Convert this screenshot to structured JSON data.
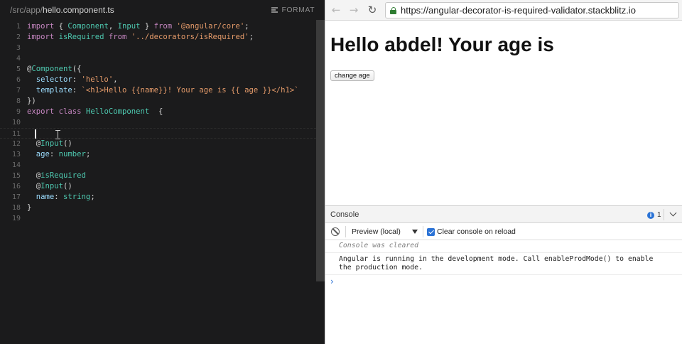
{
  "editor": {
    "breadcrumb_path": "/src/app/",
    "breadcrumb_file": "hello.component.ts",
    "format_label": "FORMAT",
    "lines": [
      {
        "n": "1",
        "tokens": [
          [
            "k",
            "import"
          ],
          [
            "p",
            " { "
          ],
          [
            "t",
            "Component"
          ],
          [
            "p",
            ", "
          ],
          [
            "t",
            "Input"
          ],
          [
            "p",
            " } "
          ],
          [
            "k",
            "from"
          ],
          [
            "p",
            " "
          ],
          [
            "s",
            "'@angular/core'"
          ],
          [
            "p",
            ";"
          ]
        ]
      },
      {
        "n": "2",
        "tokens": [
          [
            "k",
            "import"
          ],
          [
            "p",
            " "
          ],
          [
            "t",
            "isRequired"
          ],
          [
            "p",
            " "
          ],
          [
            "k",
            "from"
          ],
          [
            "p",
            " "
          ],
          [
            "s",
            "'../decorators/isRequired'"
          ],
          [
            "p",
            ";"
          ]
        ]
      },
      {
        "n": "3",
        "tokens": []
      },
      {
        "n": "4",
        "tokens": []
      },
      {
        "n": "5",
        "tokens": [
          [
            "p",
            "@"
          ],
          [
            "t",
            "Component"
          ],
          [
            "p",
            "({"
          ]
        ]
      },
      {
        "n": "6",
        "tokens": [
          [
            "pr",
            "  selector"
          ],
          [
            "p",
            ": "
          ],
          [
            "s",
            "'hello'"
          ],
          [
            "p",
            ","
          ]
        ]
      },
      {
        "n": "7",
        "tokens": [
          [
            "pr",
            "  template"
          ],
          [
            "p",
            ": "
          ],
          [
            "s",
            "`<h1>Hello {{name}}! Your age is {{ age }}</h1>`"
          ]
        ]
      },
      {
        "n": "8",
        "tokens": [
          [
            "p",
            "})"
          ]
        ]
      },
      {
        "n": "9",
        "tokens": [
          [
            "k",
            "export"
          ],
          [
            "p",
            " "
          ],
          [
            "k",
            "class"
          ],
          [
            "p",
            " "
          ],
          [
            "t",
            "HelloComponent"
          ],
          [
            "p",
            "  {"
          ]
        ]
      },
      {
        "n": "10",
        "tokens": []
      },
      {
        "n": "11",
        "tokens": [],
        "active": true
      },
      {
        "n": "12",
        "tokens": [
          [
            "p",
            "  @"
          ],
          [
            "t",
            "Input"
          ],
          [
            "p",
            "()"
          ]
        ]
      },
      {
        "n": "13",
        "tokens": [
          [
            "pr",
            "  age"
          ],
          [
            "p",
            ": "
          ],
          [
            "t",
            "number"
          ],
          [
            "p",
            ";"
          ]
        ]
      },
      {
        "n": "14",
        "tokens": []
      },
      {
        "n": "15",
        "tokens": [
          [
            "p",
            "  @"
          ],
          [
            "t",
            "isRequired"
          ]
        ]
      },
      {
        "n": "16",
        "tokens": [
          [
            "p",
            "  @"
          ],
          [
            "t",
            "Input"
          ],
          [
            "p",
            "()"
          ]
        ]
      },
      {
        "n": "17",
        "tokens": [
          [
            "pr",
            "  name"
          ],
          [
            "p",
            ": "
          ],
          [
            "t",
            "string"
          ],
          [
            "p",
            ";"
          ]
        ]
      },
      {
        "n": "18",
        "tokens": [
          [
            "p",
            "}"
          ]
        ]
      },
      {
        "n": "19",
        "tokens": []
      }
    ]
  },
  "browser": {
    "back_icon": "arrow-left",
    "forward_icon": "arrow-right",
    "reload_icon": "reload",
    "url": "https://angular-decorator-is-required-validator.stackblitz.io",
    "page_heading": "Hello abdel! Your age is",
    "change_age_button": "change age"
  },
  "console": {
    "tab_label": "Console",
    "info_count": "1",
    "context_label": "Preview (local)",
    "clear_on_reload_label": "Clear console on reload",
    "clear_on_reload_checked": true,
    "cleared_message": "Console was cleared",
    "angular_message": "Angular is running in the development mode. Call enableProdMode() to enable the production mode.",
    "prompt": "›"
  },
  "colors": {
    "keyword": "#c586c0",
    "type": "#4ec9b0",
    "string": "#e59b6a",
    "property": "#9cdcfe",
    "lock": "#2f7d32",
    "accent": "#2b73d6"
  }
}
